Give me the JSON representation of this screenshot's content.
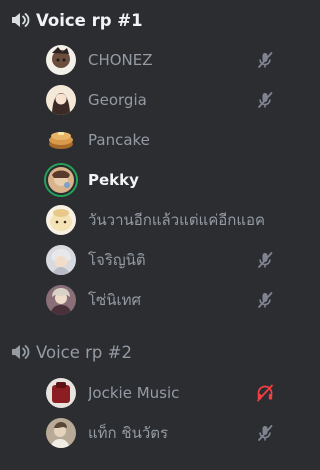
{
  "channels": [
    {
      "name": "Voice rp #1",
      "icon": "speaker-icon",
      "members": [
        {
          "name": "CHONEZ",
          "avatar_color": "#6b4e3d",
          "state": "mic-muted-icon"
        },
        {
          "name": "Georgia",
          "avatar_color": "#f4e9d8",
          "state": "mic-muted-icon"
        },
        {
          "name": "Pancake",
          "avatar_color": "#c78a3c",
          "state": ""
        },
        {
          "name": "Pekky",
          "avatar_color": "#d9b38c",
          "state": "",
          "speaking": true
        },
        {
          "name": "วันวานอีกแล้วแต่แค่อีกแอค",
          "avatar_color": "#f3e3b5",
          "state": ""
        },
        {
          "name": "โจริญนิติ",
          "avatar_color": "#d8dadf",
          "state": "mic-muted-icon"
        },
        {
          "name": "โซ่นิเทศ",
          "avatar_color": "#8a6f78",
          "state": "mic-muted-icon"
        }
      ]
    },
    {
      "name": "Voice rp #2",
      "icon": "speaker-icon",
      "members": [
        {
          "name": "Jockie Music",
          "avatar_color": "#8b1e22",
          "state": "headphones-deafened-icon"
        },
        {
          "name": "แท็ก ชินวัตร",
          "avatar_color": "#b8aa96",
          "state": "mic-muted-icon"
        }
      ]
    }
  ],
  "colors": {
    "background": "#2b2d31",
    "muted_text": "#949ba4",
    "bright_text": "#f2f3f5",
    "speaking_ring": "#23a559",
    "deafened_red": "#f23f43"
  }
}
